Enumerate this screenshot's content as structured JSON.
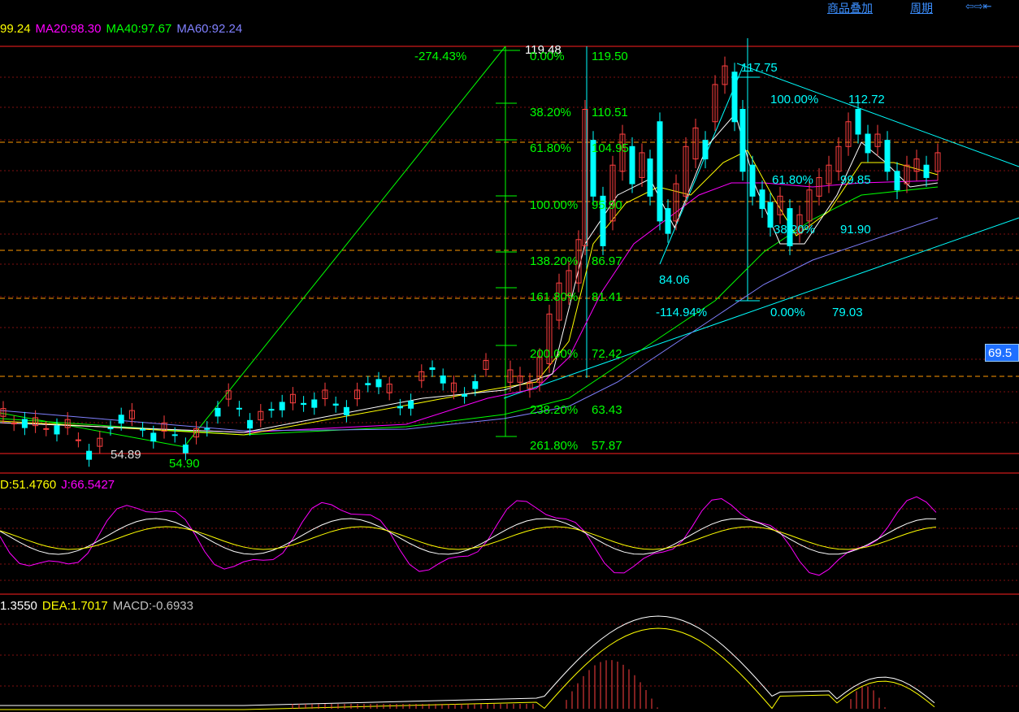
{
  "top_links": {
    "overlay": "商品叠加",
    "period": "周期",
    "nav": "⇦⇨⇤"
  },
  "main_legend": [
    {
      "text": "99.24",
      "color": "#ffff00"
    },
    {
      "text": "MA20:98.30",
      "color": "#ff00ff"
    },
    {
      "text": "MA40:97.67",
      "color": "#00ff00"
    },
    {
      "text": "MA60:92.24",
      "color": "#8080ff"
    }
  ],
  "kdj_legend": [
    {
      "text": "D:51.4760",
      "color": "#ffff00"
    },
    {
      "text": "J:66.5427",
      "color": "#ff00ff"
    }
  ],
  "macd_legend": [
    {
      "text": "1.3550",
      "color": "#ffffff"
    },
    {
      "text": "DEA:1.7017",
      "color": "#ffff00"
    },
    {
      "text": "MACD:-0.6933",
      "color": "#c0c0c0"
    }
  ],
  "price_badge": "69.5",
  "colors": {
    "up": "#ff4040",
    "down": "#00ffff",
    "ma5": "#ffffff",
    "ma10": "#ffff00",
    "ma20": "#ff00ff",
    "ma40": "#00ff00",
    "ma60": "#8080ff",
    "fib": "#00ff00",
    "fib2": "#00ffff",
    "frame": "#ff2020"
  },
  "chart_data": {
    "type": "candlestick",
    "y_axis_note": "price",
    "price_levels_marked": [
      119.48,
      54.89,
      54.9,
      117.75,
      112.72,
      99.85,
      91.9,
      84.06,
      79.03,
      69.5
    ],
    "fib_set_1": {
      "levels": [
        {
          "pct": "0.00%",
          "price": "119.50"
        },
        {
          "pct": "38.20%",
          "price": "110.51"
        },
        {
          "pct": "61.80%",
          "price": "104.95"
        },
        {
          "pct": "100.00%",
          "price": "95.90"
        },
        {
          "pct": "138.20%",
          "price": "86.97"
        },
        {
          "pct": "161.80%",
          "price": "81.41"
        },
        {
          "pct": "200.00%",
          "price": "72.42"
        },
        {
          "pct": "238.20%",
          "price": "63.43"
        },
        {
          "pct": "261.80%",
          "price": "57.87"
        }
      ],
      "ratio_label": "-274.43%"
    },
    "fib_set_2": {
      "labels": [
        {
          "text": "117.75"
        },
        {
          "text": "100.00%"
        },
        {
          "text": "112.72"
        },
        {
          "text": "61.80%"
        },
        {
          "text": "99.85"
        },
        {
          "text": "38.20%"
        },
        {
          "text": "91.90"
        },
        {
          "text": "84.06"
        },
        {
          "text": "-114.94%"
        },
        {
          "text": "0.00%"
        },
        {
          "text": "79.03"
        }
      ]
    },
    "marks": {
      "high": "119.48",
      "low_left": "54.89",
      "low_right": "54.90"
    }
  }
}
